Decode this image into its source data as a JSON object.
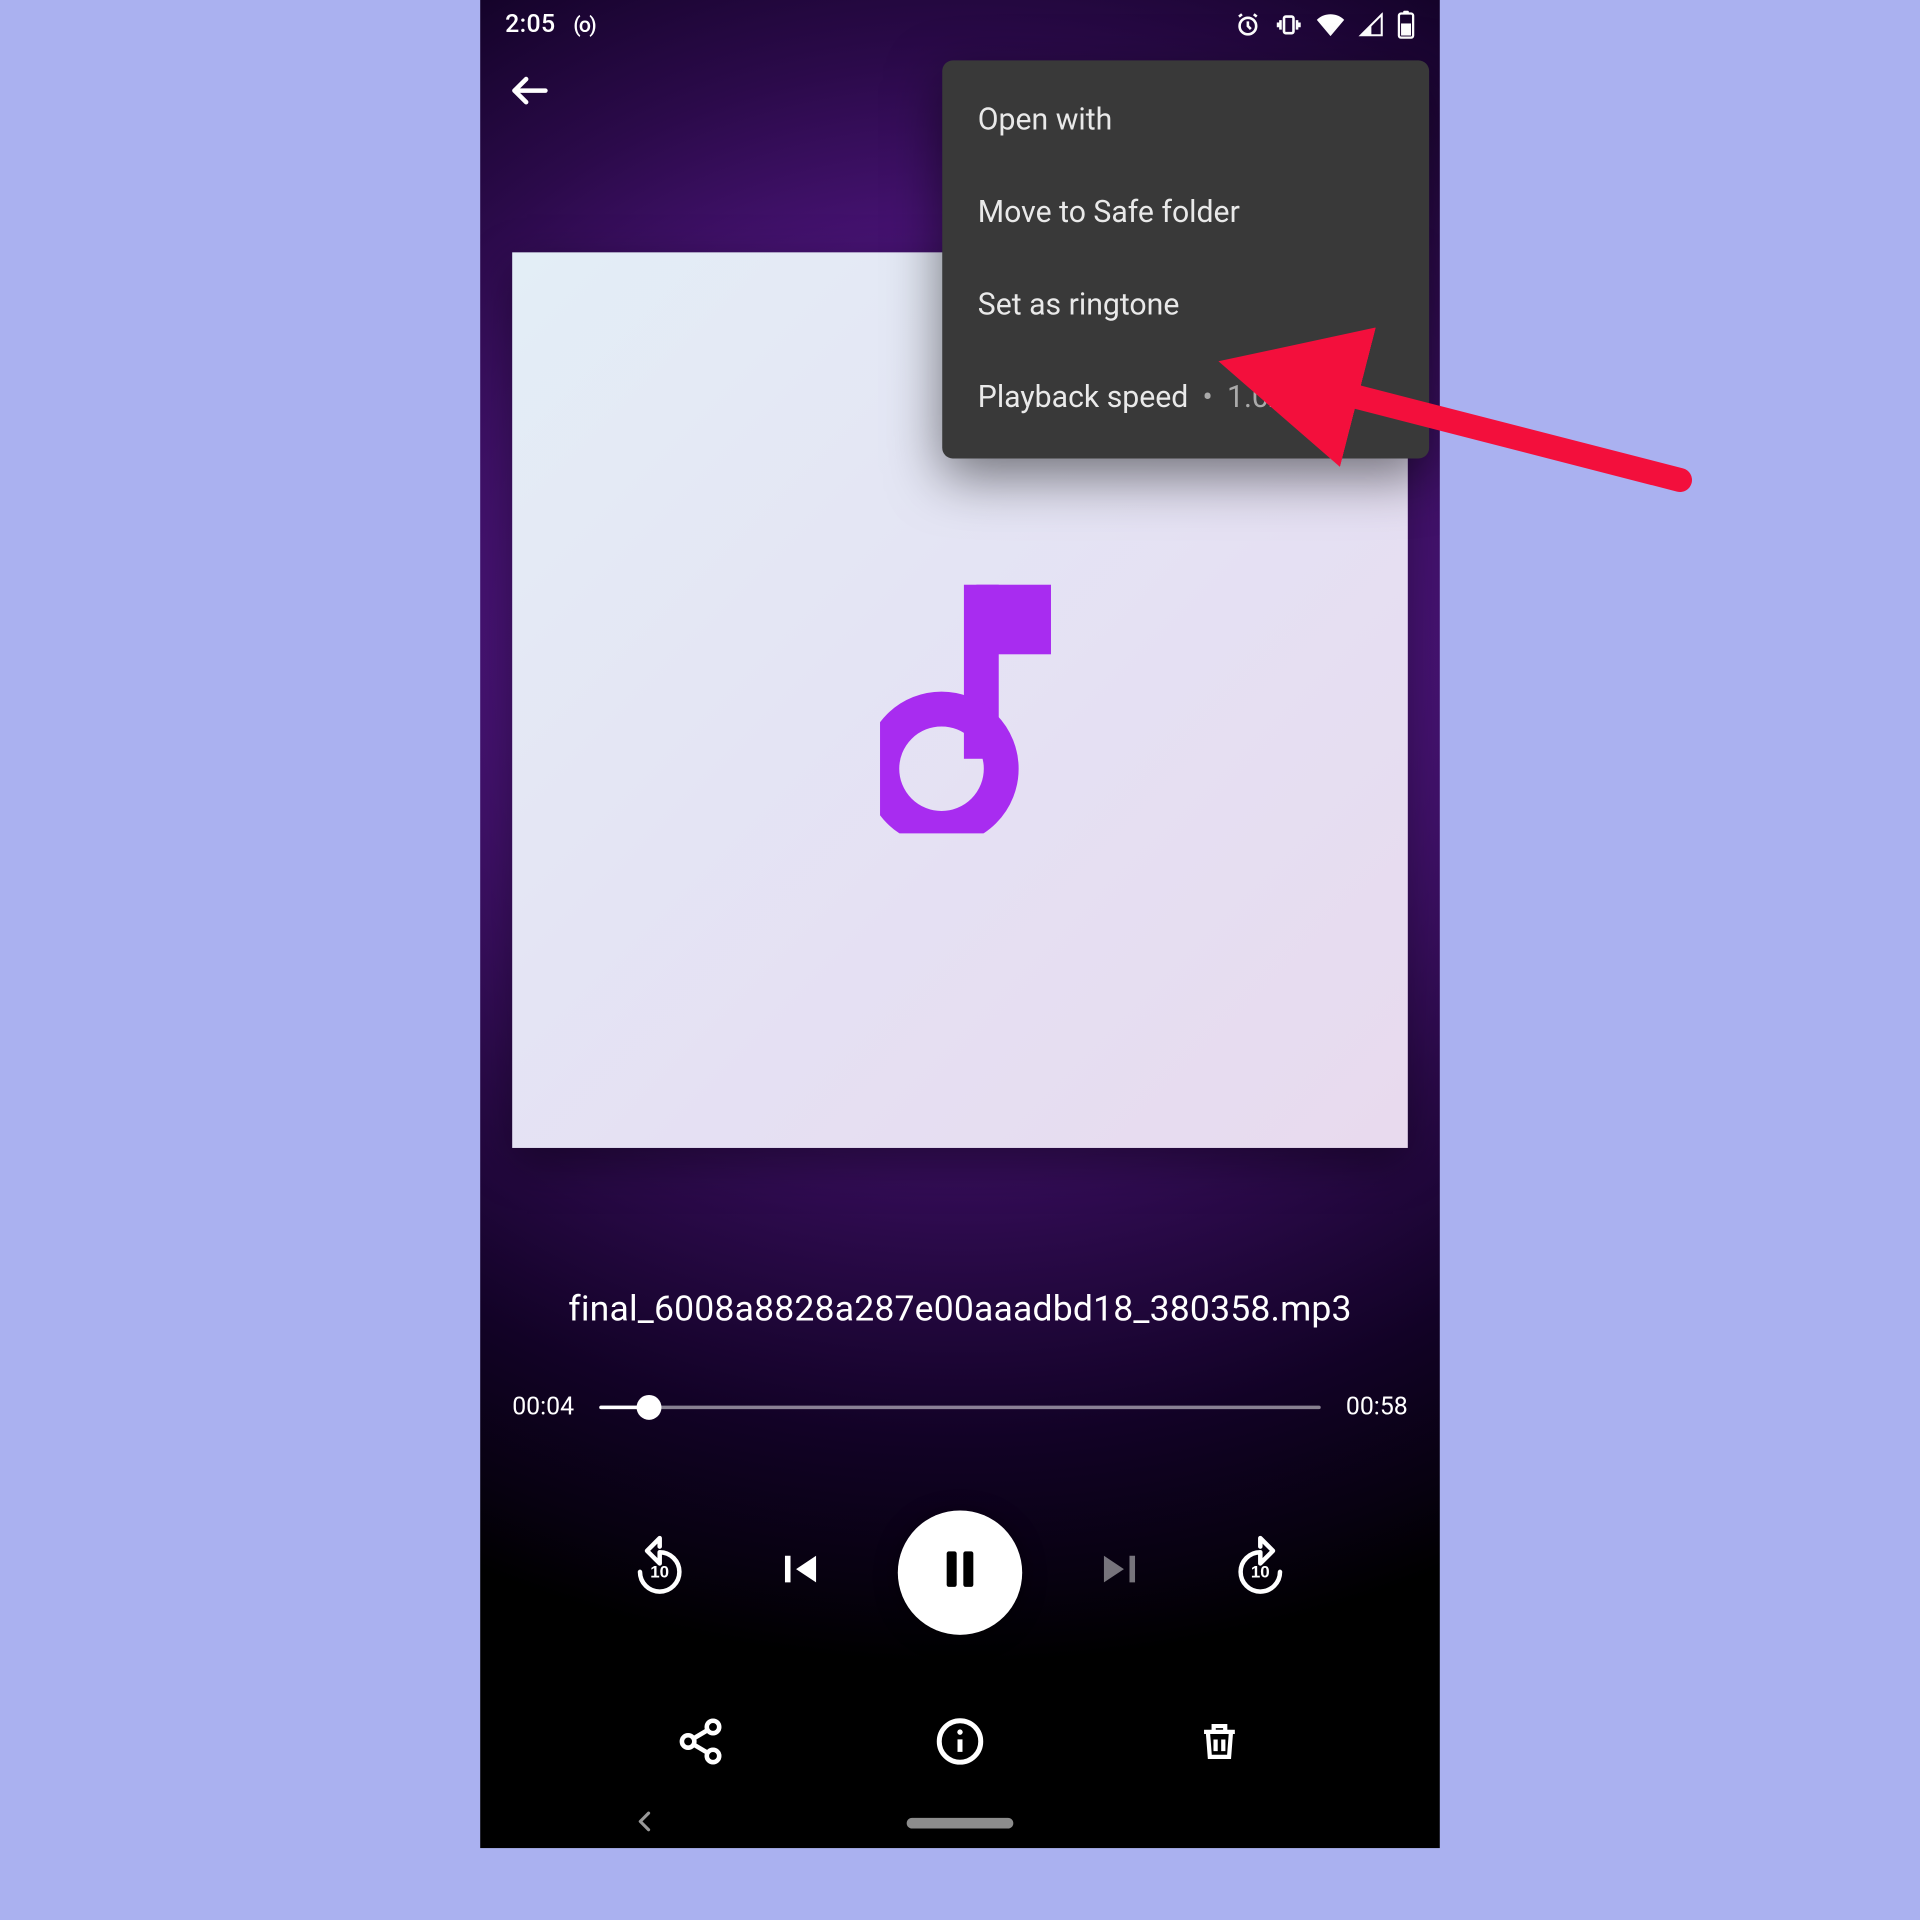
{
  "status": {
    "time": "2:05",
    "recording_indicator": "(o)"
  },
  "menu": {
    "items": [
      {
        "label": "Open with"
      },
      {
        "label": "Move to Safe folder"
      },
      {
        "label": "Set as ringtone"
      },
      {
        "label": "Playback speed",
        "value": "1.0x"
      }
    ]
  },
  "track": {
    "title": "final_6008a8828a287e00aaadbd18_380358.mp3"
  },
  "playback": {
    "elapsed": "00:04",
    "total": "00:58",
    "progress_pct": 7,
    "rewind_seconds": "10",
    "forward_seconds": "10"
  },
  "colors": {
    "accent": "#a82cf0",
    "annotation": "#f30f3c"
  }
}
